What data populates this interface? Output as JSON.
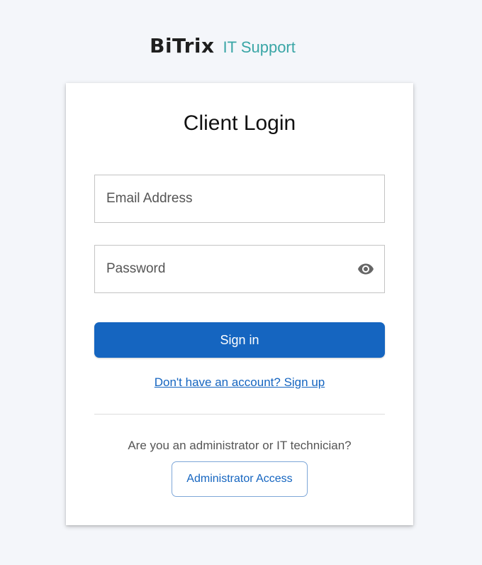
{
  "brand": {
    "name": "BiTrix",
    "subtitle": "IT Support"
  },
  "login": {
    "title": "Client Login",
    "email": {
      "placeholder": "Email Address",
      "value": ""
    },
    "password": {
      "placeholder": "Password",
      "value": "",
      "toggle_icon": "eye-icon"
    },
    "signin_label": "Sign in",
    "signup_link": "Don't have an account? Sign up",
    "admin_question": "Are you an administrator or IT technician?",
    "admin_button_label": "Administrator Access"
  },
  "colors": {
    "background": "#f4f6fa",
    "primary": "#1565c0",
    "brand_accent": "#3aa6a6",
    "icon_gray": "#666666"
  }
}
